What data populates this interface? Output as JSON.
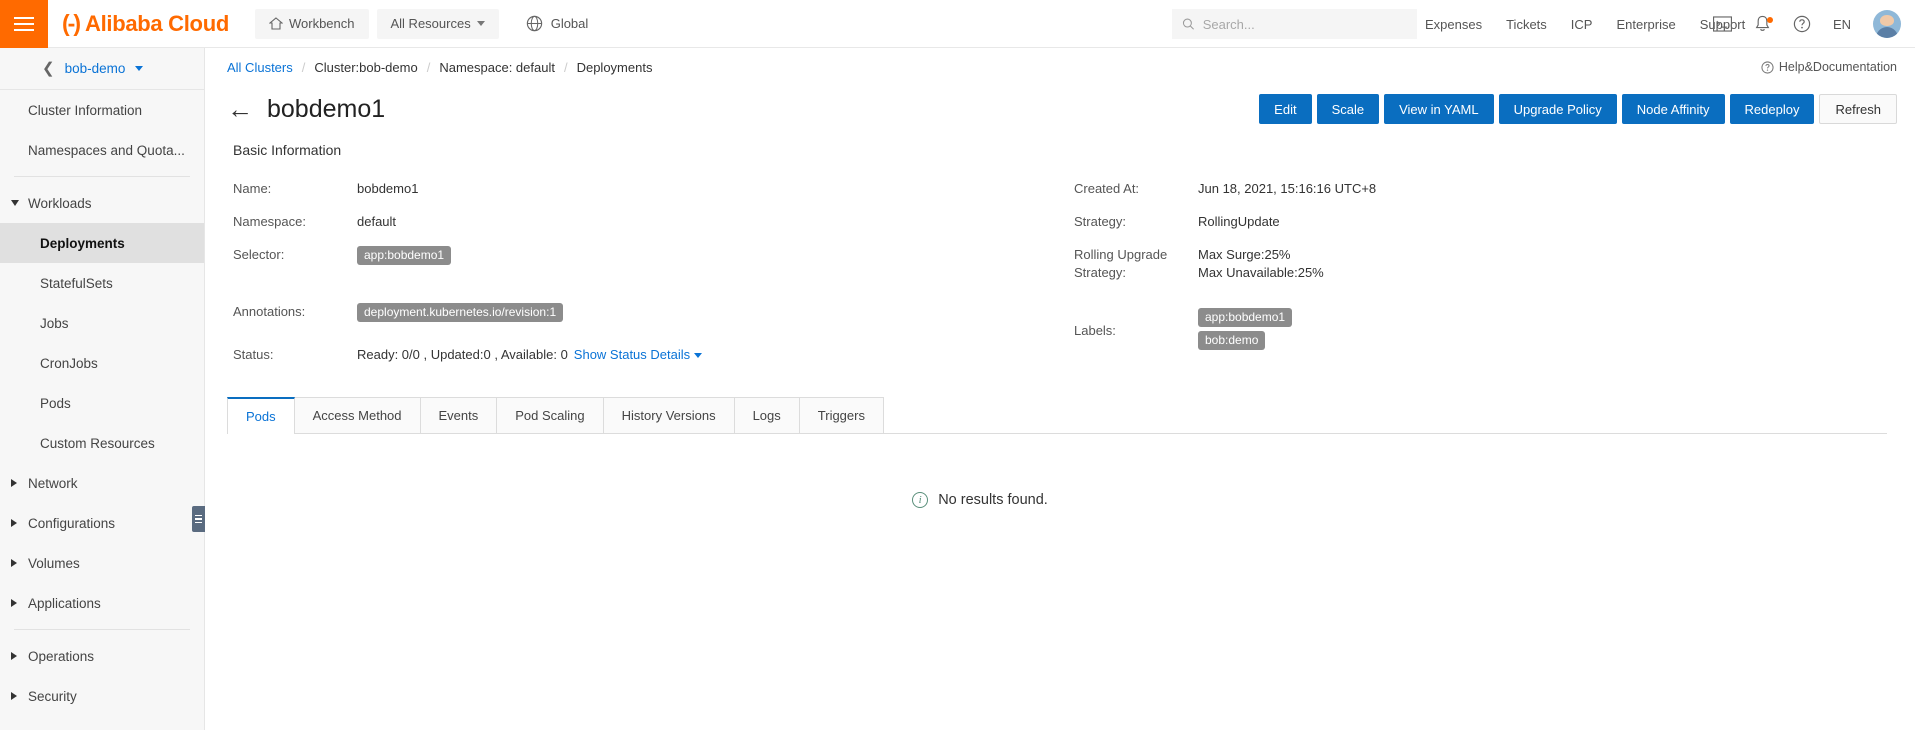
{
  "topbar": {
    "brand_mark": "(-)",
    "brand_text": "Alibaba Cloud",
    "workbench": "Workbench",
    "all_resources": "All Resources",
    "global": "Global",
    "search_placeholder": "Search...",
    "search_value": "",
    "links": [
      "Expenses",
      "Tickets",
      "ICP",
      "Enterprise",
      "Support"
    ],
    "lang": "EN"
  },
  "sidebar": {
    "cluster_name": "bob-demo",
    "items": [
      {
        "label": "Cluster Information",
        "type": "plain"
      },
      {
        "label": "Namespaces and Quota...",
        "type": "plain"
      },
      {
        "label": "Workloads",
        "type": "group-open"
      },
      {
        "label": "Deployments",
        "type": "sub-active"
      },
      {
        "label": "StatefulSets",
        "type": "sub"
      },
      {
        "label": "Jobs",
        "type": "sub"
      },
      {
        "label": "CronJobs",
        "type": "sub"
      },
      {
        "label": "Pods",
        "type": "sub"
      },
      {
        "label": "Custom Resources",
        "type": "sub"
      },
      {
        "label": "Network",
        "type": "group"
      },
      {
        "label": "Configurations",
        "type": "group"
      },
      {
        "label": "Volumes",
        "type": "group"
      },
      {
        "label": "Applications",
        "type": "group"
      },
      {
        "label": "Operations",
        "type": "group"
      },
      {
        "label": "Security",
        "type": "group"
      }
    ]
  },
  "breadcrumb": {
    "all_clusters": "All Clusters",
    "cluster": "Cluster:bob-demo",
    "namespace": "Namespace: default",
    "current": "Deployments",
    "separator": "/"
  },
  "help": {
    "label": "Help&Documentation"
  },
  "page": {
    "title": "bobdemo1",
    "buttons": [
      {
        "label": "Edit",
        "style": "primary"
      },
      {
        "label": "Scale",
        "style": "primary"
      },
      {
        "label": "View in YAML",
        "style": "primary"
      },
      {
        "label": "Upgrade Policy",
        "style": "primary"
      },
      {
        "label": "Node Affinity",
        "style": "primary"
      },
      {
        "label": "Redeploy",
        "style": "primary"
      },
      {
        "label": "Refresh",
        "style": "ghost"
      }
    ]
  },
  "basic_info": {
    "section_title": "Basic Information",
    "name_label": "Name:",
    "name_value": "bobdemo1",
    "namespace_label": "Namespace:",
    "namespace_value": "default",
    "selector_label": "Selector:",
    "selector_tags": [
      "app:bobdemo1"
    ],
    "annotations_label": "Annotations:",
    "annotations_tags": [
      "deployment.kubernetes.io/revision:1"
    ],
    "status_label": "Status:",
    "status_value": "Ready: 0/0 ,  Updated:0 ,  Available: 0",
    "show_status_details": "Show Status Details",
    "created_label": "Created At:",
    "created_value": "Jun 18, 2021, 15:16:16 UTC+8",
    "strategy_label": "Strategy:",
    "strategy_value": "RollingUpdate",
    "rolling_label": "Rolling Upgrade Strategy:",
    "rolling_value_1": "Max Surge:25%",
    "rolling_value_2": "Max Unavailable:25%",
    "labels_label": "Labels:",
    "labels_tags": [
      "app:bobdemo1",
      "bob:demo"
    ]
  },
  "tabs": [
    {
      "label": "Pods",
      "active": true
    },
    {
      "label": "Access Method",
      "active": false
    },
    {
      "label": "Events",
      "active": false
    },
    {
      "label": "Pod Scaling",
      "active": false
    },
    {
      "label": "History Versions",
      "active": false
    },
    {
      "label": "Logs",
      "active": false
    },
    {
      "label": "Triggers",
      "active": false
    }
  ],
  "empty_state": {
    "message": "No results found."
  },
  "colors": {
    "brand_orange": "#ff6a00",
    "primary_blue": "#0a6ec0",
    "link_blue": "#0a73d6",
    "tag_gray": "#8c8c8c"
  }
}
